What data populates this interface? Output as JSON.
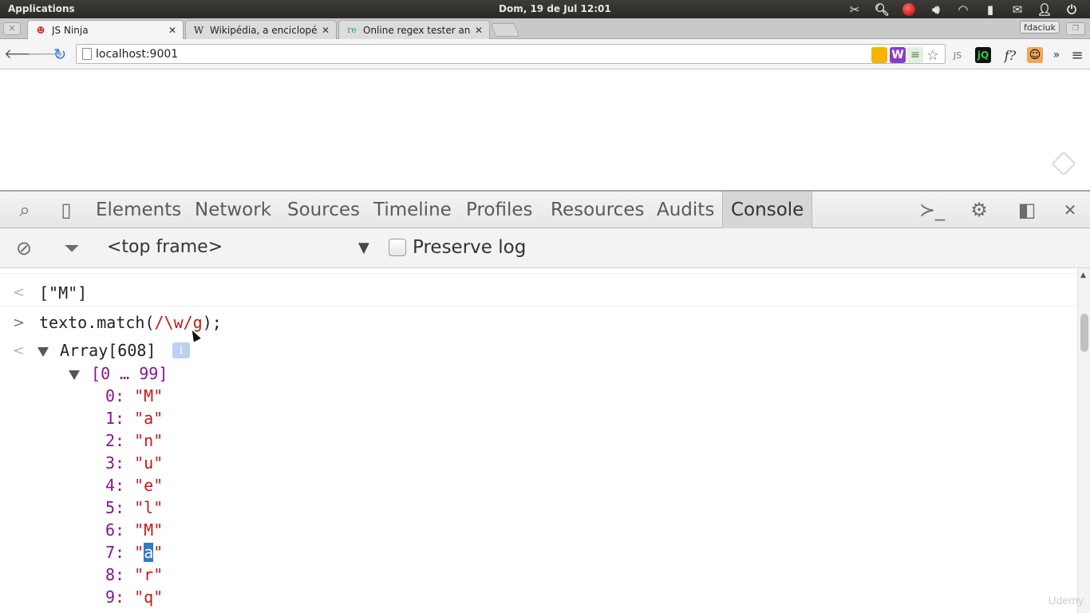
{
  "system_bar": {
    "applications_label": "Applications",
    "clock": "Dom, 19 de Jul 12:01",
    "tray_icons": [
      "scissors-icon",
      "search-icon",
      "record-icon",
      "volume-icon",
      "wifi-icon",
      "battery-icon",
      "mail-icon",
      "user-icon",
      "power-icon"
    ]
  },
  "tabs": [
    {
      "title": "JS Ninja",
      "favicon": "ninja-icon",
      "active": true
    },
    {
      "title": "Wikipédia, a enciclopédia",
      "favicon": "W",
      "active": false
    },
    {
      "title": "Online regex tester and d",
      "favicon": "re",
      "active": false
    }
  ],
  "profile_name": "fdaciuk",
  "toolbar": {
    "url": "localhost:9001"
  },
  "devtools": {
    "tabs": [
      "Elements",
      "Network",
      "Sources",
      "Timeline",
      "Profiles",
      "Resources",
      "Audits",
      "Console"
    ],
    "active_tab": "Console"
  },
  "console_bar": {
    "frame": "<top frame>",
    "preserve_log_label": "Preserve log",
    "preserve_log_checked": false
  },
  "console": {
    "prev_result": "[\"M\"]",
    "command_prefix": "texto.match(",
    "command_regex": "/\\w/g",
    "command_suffix": ");",
    "array_label": "Array[608]",
    "range_label": "[0 … 99]",
    "entries": [
      {
        "index": "0:",
        "value": "\"M\""
      },
      {
        "index": "1:",
        "value": "\"a\""
      },
      {
        "index": "2:",
        "value": "\"n\""
      },
      {
        "index": "3:",
        "value": "\"u\""
      },
      {
        "index": "4:",
        "value": "\"e\""
      },
      {
        "index": "5:",
        "value": "\"l\""
      },
      {
        "index": "6:",
        "value": "\"M\""
      },
      {
        "index": "7:",
        "value_pre": "\"",
        "value_selected": "a",
        "value_post": "\""
      },
      {
        "index": "8:",
        "value": "\"r\""
      },
      {
        "index": "9:",
        "value": "\"q\""
      }
    ]
  },
  "watermark": "Udemy"
}
